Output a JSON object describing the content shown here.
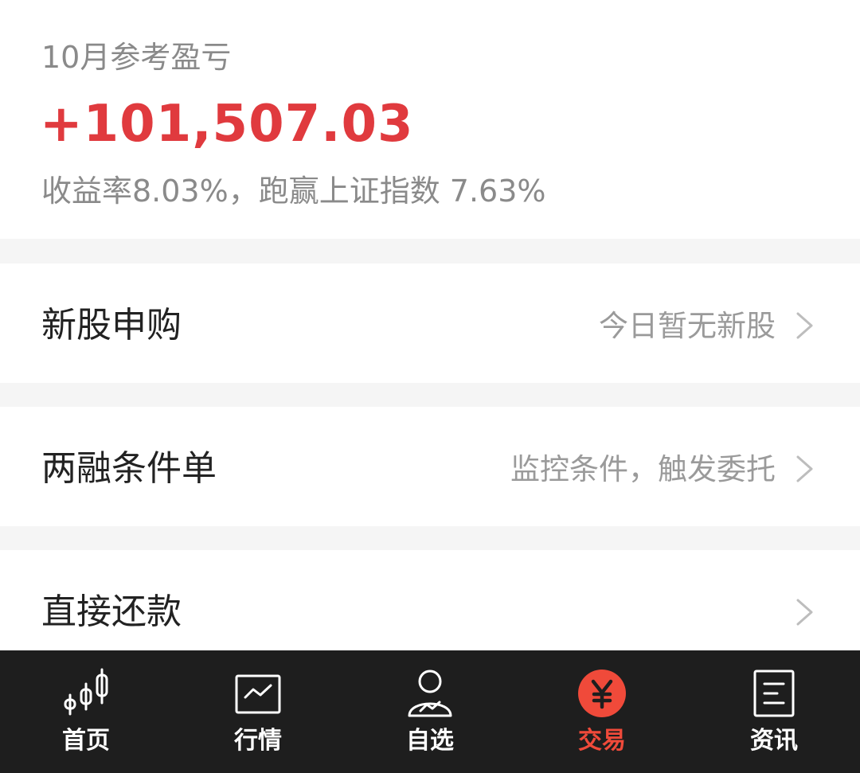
{
  "summary": {
    "label": "10月参考盈亏",
    "value": "+101,507.03",
    "subtitle": "收益率8.03%，跑赢上证指数 7.63%"
  },
  "rows": [
    {
      "title": "新股申购",
      "hint": "今日暂无新股"
    },
    {
      "title": "两融条件单",
      "hint": "监控条件，触发委托"
    },
    {
      "title": "直接还款",
      "hint": ""
    }
  ],
  "tabs": [
    {
      "label": "首页",
      "icon": "candlestick-chart-icon"
    },
    {
      "label": "行情",
      "icon": "line-chart-icon"
    },
    {
      "label": "自选",
      "icon": "user-chart-icon"
    },
    {
      "label": "交易",
      "icon": "yen-icon",
      "active": true
    },
    {
      "label": "资讯",
      "icon": "document-icon"
    }
  ],
  "colors": {
    "profit_red": "#e03a3e",
    "accent": "#f04a3a",
    "tabbar_bg": "#1e1e1e",
    "muted_text": "#8a8a8a"
  }
}
